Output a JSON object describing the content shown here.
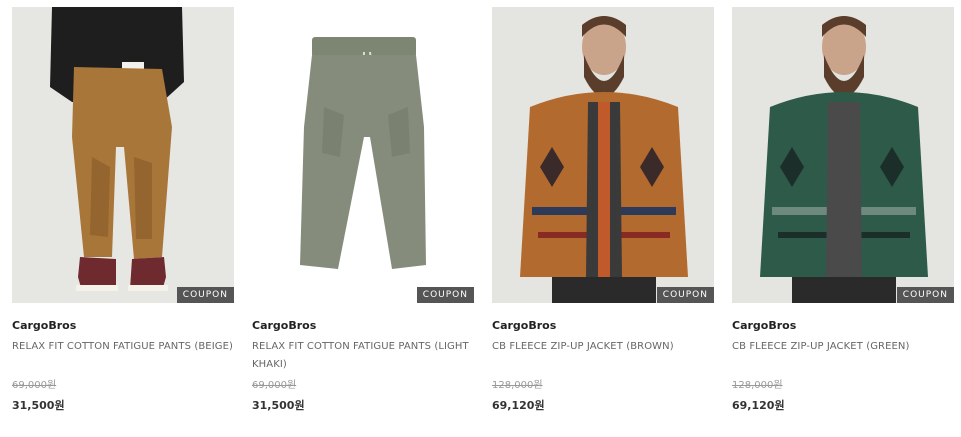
{
  "products": [
    {
      "brand": "CargoBros",
      "name": "RELAX FIT COTTON FATIGUE PANTS (BEIGE)",
      "original_price": "69,000원",
      "sale_price": "31,500원",
      "badge": "COUPON",
      "image_icon": "beige-pants-model-photo"
    },
    {
      "brand": "CargoBros",
      "name": "RELAX FIT COTTON FATIGUE PANTS (LIGHT KHAKI)",
      "original_price": "69,000원",
      "sale_price": "31,500원",
      "badge": "COUPON",
      "image_icon": "khaki-pants-product-photo"
    },
    {
      "brand": "CargoBros",
      "name": "CB FLEECE ZIP-UP JACKET (BROWN)",
      "original_price": "128,000원",
      "sale_price": "69,120원",
      "badge": "COUPON",
      "image_icon": "brown-fleece-jacket-model-photo"
    },
    {
      "brand": "CargoBros",
      "name": "CB FLEECE ZIP-UP JACKET (GREEN)",
      "original_price": "128,000원",
      "sale_price": "69,120원",
      "badge": "COUPON",
      "image_icon": "green-fleece-jacket-model-photo"
    }
  ],
  "colors": {
    "coupon_bg": "#555555",
    "original_price": "#999999",
    "sale_price": "#333333"
  }
}
